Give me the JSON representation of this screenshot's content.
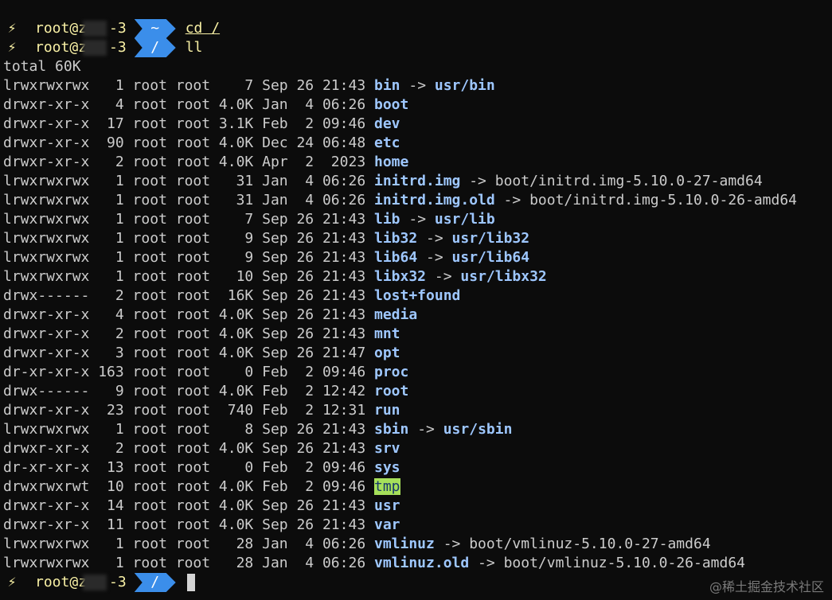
{
  "prompts": [
    {
      "icon": "bolt-icon",
      "bolt": "⚡",
      "user": "root@z",
      "user_tail": "-3",
      "path": "~",
      "command": "cd /"
    },
    {
      "icon": "bolt-icon",
      "bolt": "⚡",
      "user": "root@z",
      "user_tail": "-3",
      "path": "/",
      "command": "ll"
    }
  ],
  "total": "total 60K",
  "entries": [
    {
      "meta": "lrwxrwxrwx   1 root root    7 Sep 26 21:43 ",
      "name": "bin",
      "arrow": " -> ",
      "target": "usr/bin",
      "target_type": "dir"
    },
    {
      "meta": "drwxr-xr-x   4 root root 4.0K Jan  4 06:26 ",
      "name": "boot",
      "arrow": "",
      "target": "",
      "target_type": ""
    },
    {
      "meta": "drwxr-xr-x  17 root root 3.1K Feb  2 09:46 ",
      "name": "dev",
      "arrow": "",
      "target": "",
      "target_type": ""
    },
    {
      "meta": "drwxr-xr-x  90 root root 4.0K Dec 24 06:48 ",
      "name": "etc",
      "arrow": "",
      "target": "",
      "target_type": ""
    },
    {
      "meta": "drwxr-xr-x   2 root root 4.0K Apr  2  2023 ",
      "name": "home",
      "arrow": "",
      "target": "",
      "target_type": ""
    },
    {
      "meta": "lrwxrwxrwx   1 root root   31 Jan  4 06:26 ",
      "name": "initrd.img",
      "arrow": " -> ",
      "target": "boot/initrd.img-5.10.0-27-amd64",
      "target_type": "file"
    },
    {
      "meta": "lrwxrwxrwx   1 root root   31 Jan  4 06:26 ",
      "name": "initrd.img.old",
      "arrow": " -> ",
      "target": "boot/initrd.img-5.10.0-26-amd64",
      "target_type": "file"
    },
    {
      "meta": "lrwxrwxrwx   1 root root    7 Sep 26 21:43 ",
      "name": "lib",
      "arrow": " -> ",
      "target": "usr/lib",
      "target_type": "dir"
    },
    {
      "meta": "lrwxrwxrwx   1 root root    9 Sep 26 21:43 ",
      "name": "lib32",
      "arrow": " -> ",
      "target": "usr/lib32",
      "target_type": "dir"
    },
    {
      "meta": "lrwxrwxrwx   1 root root    9 Sep 26 21:43 ",
      "name": "lib64",
      "arrow": " -> ",
      "target": "usr/lib64",
      "target_type": "dir"
    },
    {
      "meta": "lrwxrwxrwx   1 root root   10 Sep 26 21:43 ",
      "name": "libx32",
      "arrow": " -> ",
      "target": "usr/libx32",
      "target_type": "dir"
    },
    {
      "meta": "drwx------   2 root root  16K Sep 26 21:43 ",
      "name": "lost+found",
      "arrow": "",
      "target": "",
      "target_type": ""
    },
    {
      "meta": "drwxr-xr-x   4 root root 4.0K Sep 26 21:43 ",
      "name": "media",
      "arrow": "",
      "target": "",
      "target_type": ""
    },
    {
      "meta": "drwxr-xr-x   2 root root 4.0K Sep 26 21:43 ",
      "name": "mnt",
      "arrow": "",
      "target": "",
      "target_type": ""
    },
    {
      "meta": "drwxr-xr-x   3 root root 4.0K Sep 26 21:47 ",
      "name": "opt",
      "arrow": "",
      "target": "",
      "target_type": ""
    },
    {
      "meta": "dr-xr-xr-x 163 root root    0 Feb  2 09:46 ",
      "name": "proc",
      "arrow": "",
      "target": "",
      "target_type": ""
    },
    {
      "meta": "drwx------   9 root root 4.0K Feb  2 12:42 ",
      "name": "root",
      "arrow": "",
      "target": "",
      "target_type": ""
    },
    {
      "meta": "drwxr-xr-x  23 root root  740 Feb  2 12:31 ",
      "name": "run",
      "arrow": "",
      "target": "",
      "target_type": ""
    },
    {
      "meta": "lrwxrwxrwx   1 root root    8 Sep 26 21:43 ",
      "name": "sbin",
      "arrow": " -> ",
      "target": "usr/sbin",
      "target_type": "dir"
    },
    {
      "meta": "drwxr-xr-x   2 root root 4.0K Sep 26 21:43 ",
      "name": "srv",
      "arrow": "",
      "target": "",
      "target_type": ""
    },
    {
      "meta": "dr-xr-xr-x  13 root root    0 Feb  2 09:46 ",
      "name": "sys",
      "arrow": "",
      "target": "",
      "target_type": ""
    },
    {
      "meta": "drwxrwxrwt  10 root root 4.0K Feb  2 09:46 ",
      "name": "tmp",
      "arrow": "",
      "target": "",
      "target_type": "",
      "sticky": true
    },
    {
      "meta": "drwxr-xr-x  14 root root 4.0K Sep 26 21:43 ",
      "name": "usr",
      "arrow": "",
      "target": "",
      "target_type": ""
    },
    {
      "meta": "drwxr-xr-x  11 root root 4.0K Sep 26 21:43 ",
      "name": "var",
      "arrow": "",
      "target": "",
      "target_type": ""
    },
    {
      "meta": "lrwxrwxrwx   1 root root   28 Jan  4 06:26 ",
      "name": "vmlinuz",
      "arrow": " -> ",
      "target": "boot/vmlinuz-5.10.0-27-amd64",
      "target_type": "file"
    },
    {
      "meta": "lrwxrwxrwx   1 root root   28 Jan  4 06:26 ",
      "name": "vmlinuz.old",
      "arrow": " -> ",
      "target": "boot/vmlinuz-5.10.0-26-amd64",
      "target_type": "file"
    }
  ],
  "final_prompt": {
    "icon": "bolt-icon",
    "bolt": "⚡",
    "user": "root@z",
    "user_tail": "-3",
    "path": "/"
  },
  "watermark": "@稀土掘金技术社区",
  "colors": {
    "background": "#0c0c0c",
    "prompt_text": "#f9f1a5",
    "segment": "#3b8eea",
    "dir_name": "#9ec7ff",
    "sticky_bg": "#a6e05a"
  }
}
